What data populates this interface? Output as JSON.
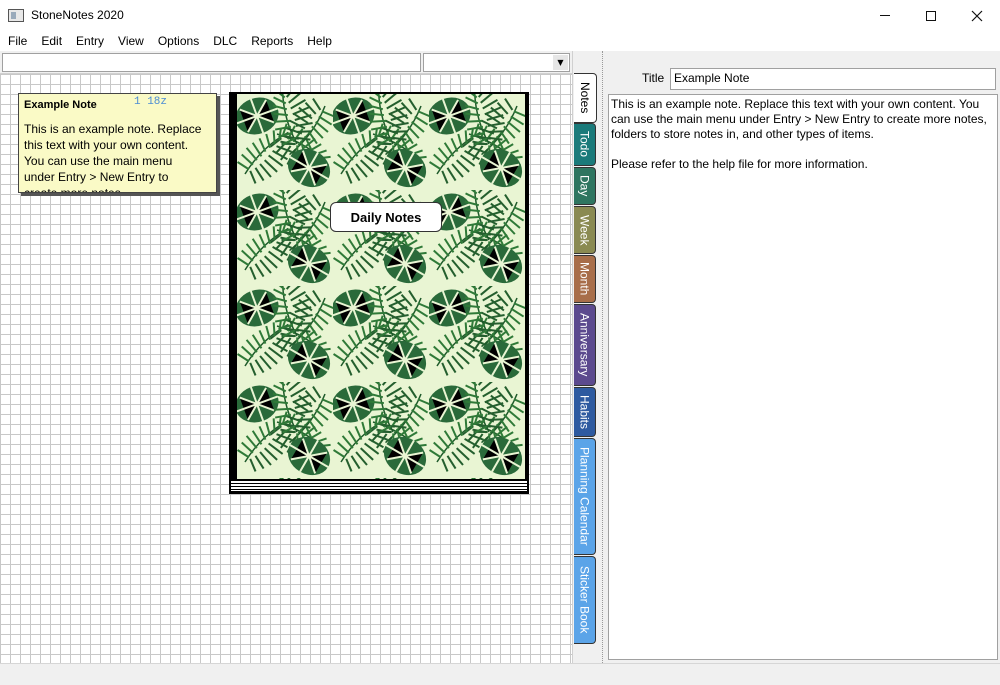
{
  "window": {
    "title": "StoneNotes 2020"
  },
  "menu": [
    "File",
    "Edit",
    "Entry",
    "View",
    "Options",
    "DLC",
    "Reports",
    "Help"
  ],
  "left_toolbar": {
    "search_value": "",
    "combo_value": ""
  },
  "sticky_note": {
    "title": "Example Note",
    "meta": "1 18z",
    "body": "This is an example note. Replace this text with your own content. You can use the main menu under Entry > New Entry to create more notes,"
  },
  "notebook": {
    "label": "Daily Notes"
  },
  "tabs": [
    {
      "label": "Notes",
      "color": "#ffffff"
    },
    {
      "label": "Todo",
      "color": "#1a7a7a"
    },
    {
      "label": "Day",
      "color": "#2e7560"
    },
    {
      "label": "Week",
      "color": "#8a8a52"
    },
    {
      "label": "Month",
      "color": "#a86e4a"
    },
    {
      "label": "Anniversary",
      "color": "#5c4a8e"
    },
    {
      "label": "Habits",
      "color": "#2e5aa0"
    },
    {
      "label": "Planning Calendar",
      "color": "#5ba4e8"
    },
    {
      "label": "Sticker Book",
      "color": "#5ba4e8"
    }
  ],
  "editor": {
    "title_label": "Title",
    "title_value": "Example Note",
    "paragraph1": "This is an example note. Replace this text with your own content. You can use the main menu under Entry > New Entry to create more notes, folders to store notes in, and other types of items.",
    "paragraph2": "Please refer to the help file for more information."
  }
}
